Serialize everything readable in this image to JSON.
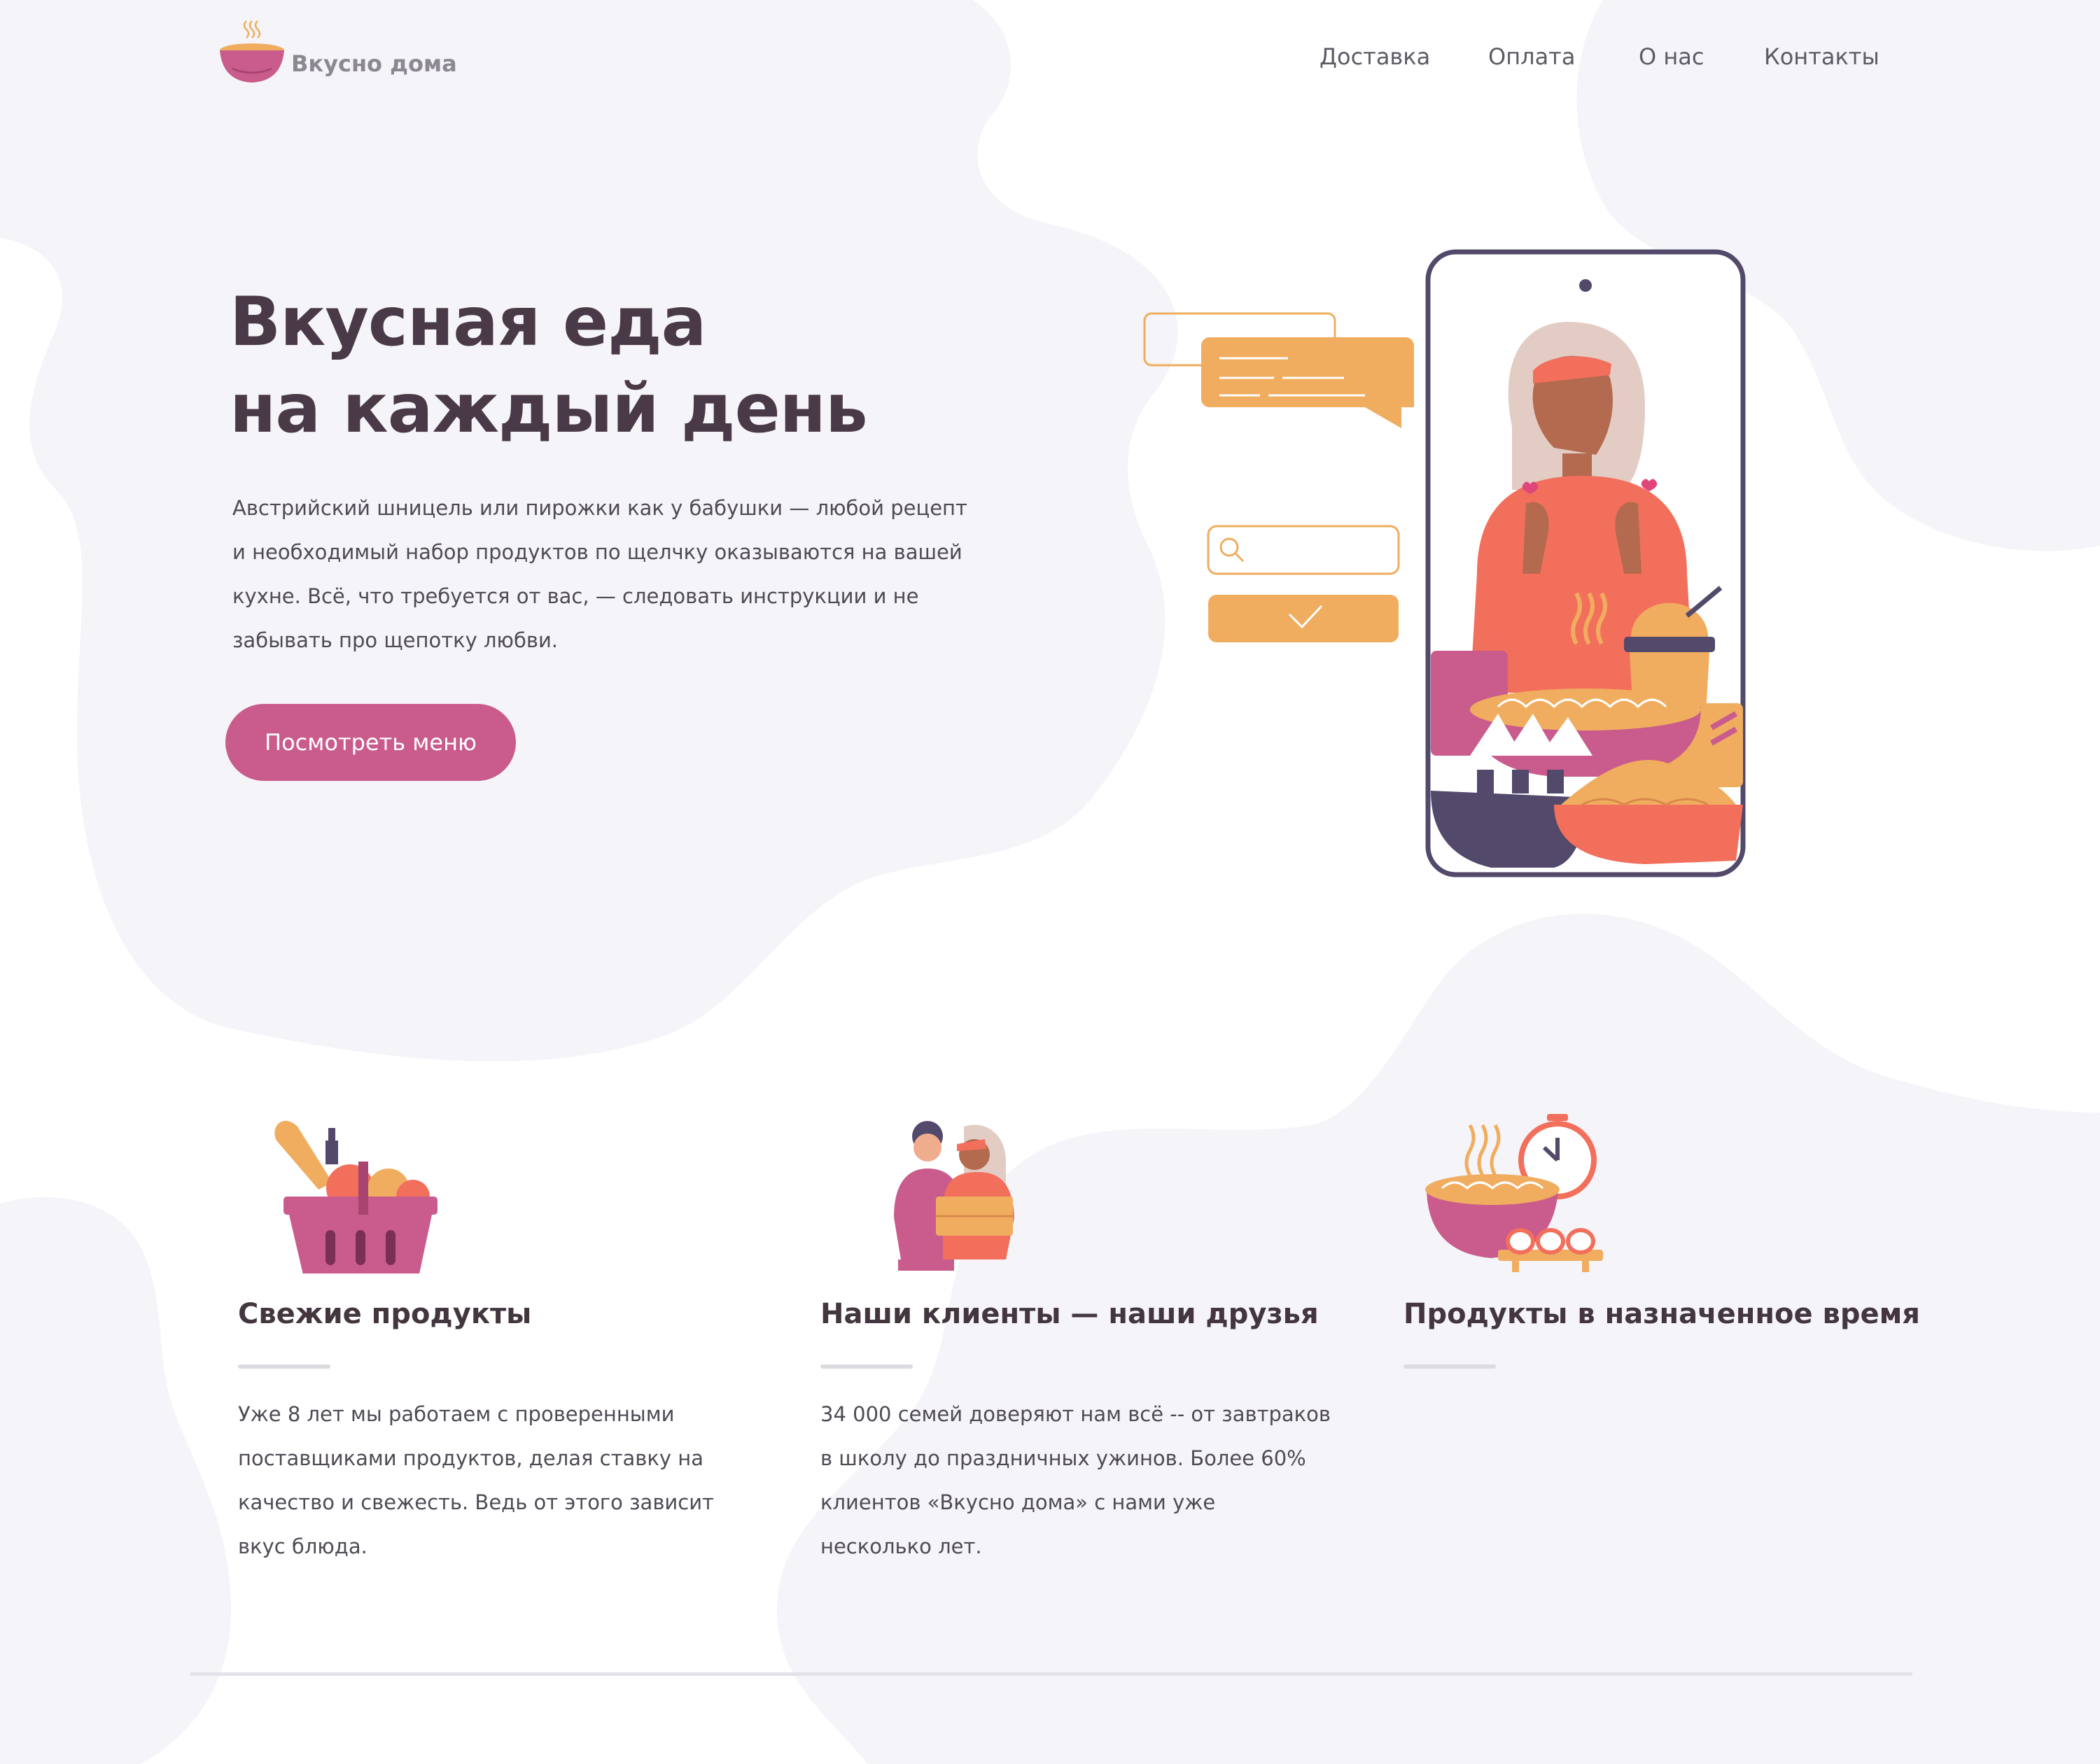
{
  "header": {
    "logo_text": "Вкусно дома",
    "nav": [
      "Доставка",
      "Оплата",
      "О нас",
      "Контакты"
    ]
  },
  "hero": {
    "title_lines": [
      "Вкусная еда",
      "на каждый день"
    ],
    "description_lines": [
      "Австрийский шницель или пирожки как у бабушки — любой рецепт",
      "и необходимый набор продуктов по щелчку оказываются на вашей",
      "кухне. Всё, что требуется от вас, — следовать инструкции и не",
      "забывать про щепотку любви."
    ],
    "cta_label": "Посмотреть меню"
  },
  "features": [
    {
      "icon": "basket-icon",
      "title": "Свежие продукты",
      "text_lines": [
        "Уже 8 лет мы работаем с проверенными",
        "поставщиками продуктов, делая ставку на",
        "качество и свежесть. Ведь от этого зависит",
        "вкус блюда."
      ]
    },
    {
      "icon": "friends-icon",
      "title": "Наши клиенты — наши друзья",
      "text_lines": [
        "34 000 семей доверяют нам всё -- от завтраков",
        "в школу до праздничных ужинов. Более 60%",
        "клиентов «Вкусно дома» с нами уже",
        "несколько лет."
      ]
    },
    {
      "icon": "timer-bowl-icon",
      "title": "Продукты в назначенное время",
      "text_lines": []
    }
  ],
  "colors": {
    "accent": "#c95c8c",
    "orange": "#f0ad5f",
    "coral": "#f26f5c",
    "dark": "#4a3a47",
    "blob": "#f5f4f8"
  }
}
